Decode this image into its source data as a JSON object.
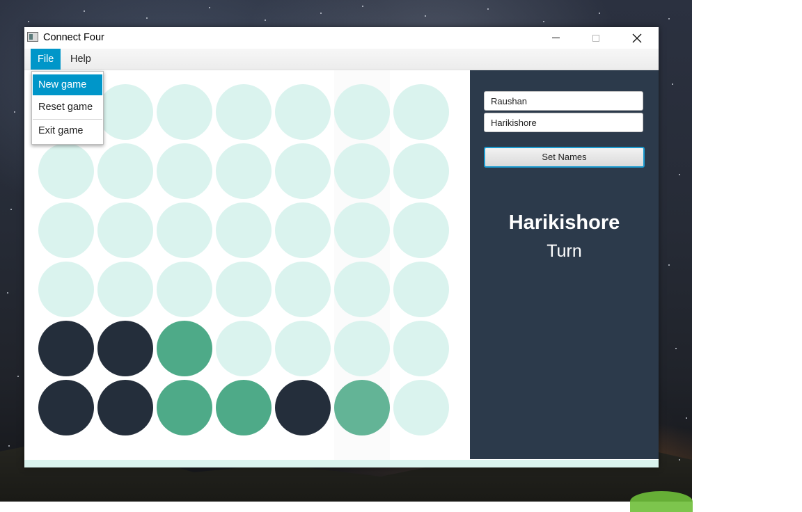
{
  "window": {
    "title": "Connect Four"
  },
  "menu": {
    "items": [
      {
        "label": "File"
      },
      {
        "label": "Help"
      }
    ],
    "file_dropdown": [
      {
        "label": "New game"
      },
      {
        "label": "Reset game"
      },
      {
        "label": "Exit game"
      }
    ]
  },
  "panel": {
    "player_one": "Raushan",
    "player_two": "Harikishore",
    "set_names_label": "Set Names",
    "current_player": "Harikishore",
    "turn_label": "Turn"
  },
  "board": {
    "columns": 7,
    "rows": 6,
    "colors": {
      "empty": "#daf3ee",
      "player_one": "#242e3b",
      "player_two": "#4eaa88",
      "last_move": "#63b496"
    },
    "cells": [
      [
        "empty",
        "empty",
        "empty",
        "empty",
        "empty",
        "empty",
        "empty"
      ],
      [
        "empty",
        "empty",
        "empty",
        "empty",
        "empty",
        "empty",
        "empty"
      ],
      [
        "empty",
        "empty",
        "empty",
        "empty",
        "empty",
        "empty",
        "empty"
      ],
      [
        "empty",
        "empty",
        "empty",
        "empty",
        "empty",
        "empty",
        "empty"
      ],
      [
        "player_one",
        "player_one",
        "player_two",
        "empty",
        "empty",
        "empty",
        "empty"
      ],
      [
        "player_one",
        "player_one",
        "player_two",
        "player_two",
        "player_one",
        "last_move",
        "empty"
      ]
    ]
  }
}
